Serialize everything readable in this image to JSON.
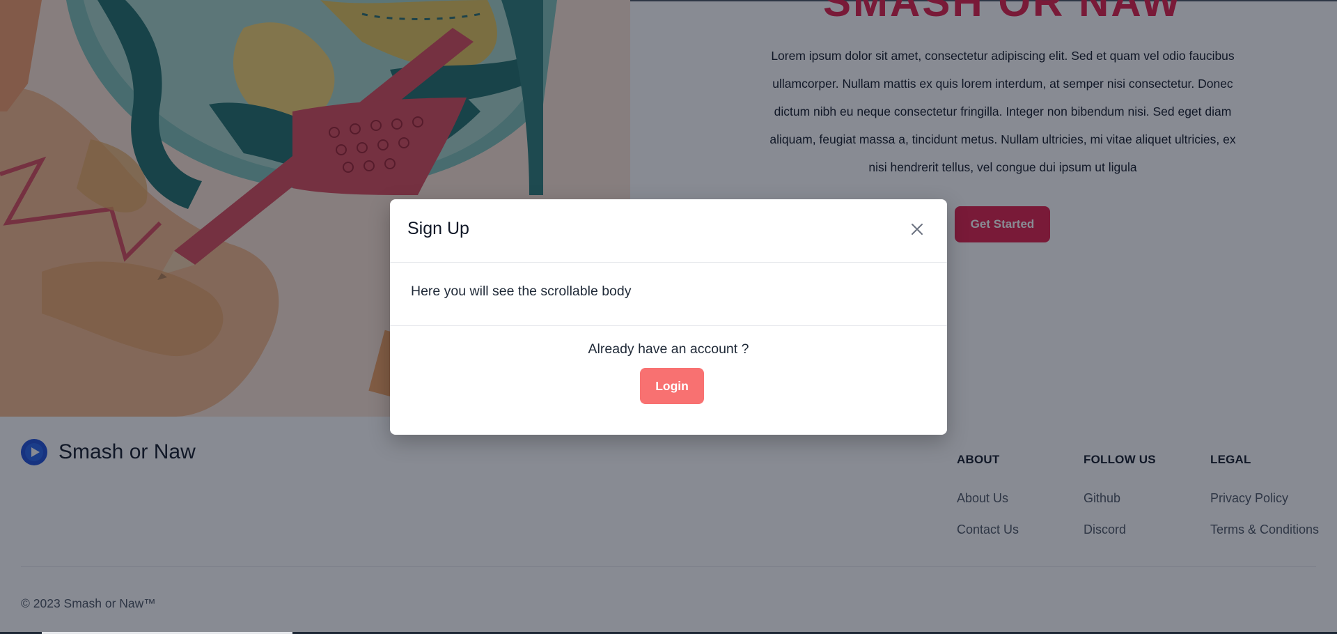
{
  "hero": {
    "title": "SMASH OR NAW",
    "body": "Lorem ipsum dolor sit amet, consectetur adipiscing elit. Sed et quam vel odio faucibus ullamcorper. Nullam mattis ex quis lorem interdum, at semper nisi consectetur. Donec dictum nibh eu neque consectetur fringilla. Integer non bibendum nisi. Sed eget diam aliquam, feugiat massa a, tincidunt metus. Nullam ultricies, mi vitae aliquet ultricies, ex nisi hendrerit tellus, vel congue dui ipsum ut ligula",
    "cta_label": "Get Started"
  },
  "footer": {
    "brand_name": "Smash or Naw",
    "columns": [
      {
        "heading": "ABOUT",
        "links": [
          "About Us",
          "Contact Us"
        ]
      },
      {
        "heading": "FOLLOW US",
        "links": [
          "Github",
          "Discord"
        ]
      },
      {
        "heading": "LEGAL",
        "links": [
          "Privacy Policy",
          "Terms & Conditions"
        ]
      }
    ],
    "copyright": "© 2023 Smash or Naw™"
  },
  "modal": {
    "title": "Sign Up",
    "body_text": "Here you will see the scrollable body",
    "question": "Already have an account ?",
    "login_label": "Login"
  },
  "colors": {
    "brand_red": "#e11d48",
    "login_button": "#f87171",
    "backdrop": "rgba(17,24,39,0.5)"
  },
  "icons": {
    "close": "close-icon",
    "brand_logo": "play-logo-icon"
  }
}
